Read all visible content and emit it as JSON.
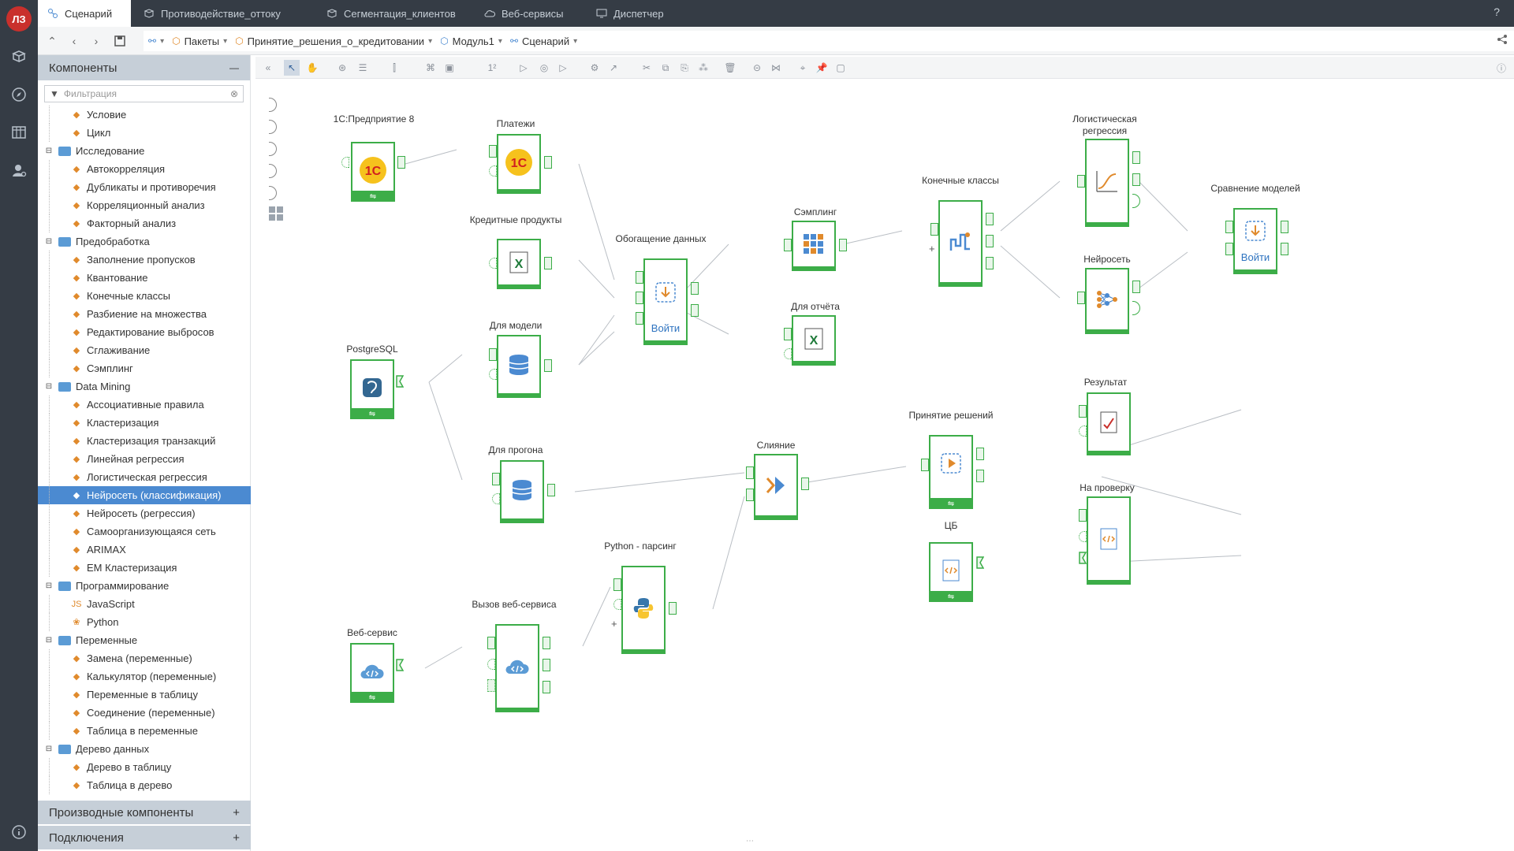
{
  "rail": {
    "logo": "ЛЗ"
  },
  "tabs": [
    {
      "label": "Сценарий",
      "active": true
    },
    {
      "label": "Противодействие_оттоку"
    },
    {
      "label": "Сегментация_клиентов"
    },
    {
      "label": "Веб-сервисы"
    },
    {
      "label": "Диспетчер"
    }
  ],
  "help": "?",
  "breadcrumbs": [
    "Пакеты",
    "Принятие_решения_о_кредитовании",
    "Модуль1",
    "Сценарий"
  ],
  "panel": {
    "title": "Компоненты",
    "filter_placeholder": "Фильтрация",
    "tree": [
      {
        "label": "Условие",
        "level": 2
      },
      {
        "label": "Цикл",
        "level": 2
      },
      {
        "label": "Исследование",
        "level": 1
      },
      {
        "label": "Автокорреляция",
        "level": 2
      },
      {
        "label": "Дубликаты и противоречия",
        "level": 2
      },
      {
        "label": "Корреляционный анализ",
        "level": 2
      },
      {
        "label": "Факторный анализ",
        "level": 2
      },
      {
        "label": "Предобработка",
        "level": 1
      },
      {
        "label": "Заполнение пропусков",
        "level": 2
      },
      {
        "label": "Квантование",
        "level": 2
      },
      {
        "label": "Конечные классы",
        "level": 2
      },
      {
        "label": "Разбиение на множества",
        "level": 2
      },
      {
        "label": "Редактирование выбросов",
        "level": 2
      },
      {
        "label": "Сглаживание",
        "level": 2
      },
      {
        "label": "Сэмплинг",
        "level": 2
      },
      {
        "label": "Data Mining",
        "level": 1
      },
      {
        "label": "Ассоциативные правила",
        "level": 2
      },
      {
        "label": "Кластеризация",
        "level": 2
      },
      {
        "label": "Кластеризация транзакций",
        "level": 2
      },
      {
        "label": "Линейная регрессия",
        "level": 2
      },
      {
        "label": "Логистическая регрессия",
        "level": 2
      },
      {
        "label": "Нейросеть (классификация)",
        "level": 2,
        "selected": true
      },
      {
        "label": "Нейросеть (регрессия)",
        "level": 2
      },
      {
        "label": "Самоорганизующаяся сеть",
        "level": 2
      },
      {
        "label": "ARIMAX",
        "level": 2
      },
      {
        "label": "EM Кластеризация",
        "level": 2
      },
      {
        "label": "Программирование",
        "level": 1
      },
      {
        "label": "JavaScript",
        "level": 2
      },
      {
        "label": "Python",
        "level": 2
      },
      {
        "label": "Переменные",
        "level": 1
      },
      {
        "label": "Замена (переменные)",
        "level": 2
      },
      {
        "label": "Калькулятор (переменные)",
        "level": 2
      },
      {
        "label": "Переменные в таблицу",
        "level": 2
      },
      {
        "label": "Соединение (переменные)",
        "level": 2
      },
      {
        "label": "Таблица в переменные",
        "level": 2
      },
      {
        "label": "Дерево данных",
        "level": 1
      },
      {
        "label": "Дерево в таблицу",
        "level": 2
      },
      {
        "label": "Таблица в дерево",
        "level": 2
      }
    ],
    "derived": "Производные компоненты",
    "connections": "Подключения",
    "plus": "+",
    "minus": "—"
  },
  "nodes": {
    "onec": "1С:Предприятие 8",
    "payments": "Платежи",
    "credit": "Кредитные продукты",
    "enrich": "Обогащение данных",
    "enrich_run": "Войти",
    "sampling": "Сэмплинг",
    "report": "Для отчёта",
    "model": "Для модели",
    "postgres": "PostgreSQL",
    "classes": "Конечные классы",
    "logreg": "Логистическая регрессия",
    "neural": "Нейросеть",
    "compare": "Сравнение моделей",
    "compare_run": "Войти",
    "forecast": "Для прогона",
    "merge": "Слияние",
    "decision": "Принятие решений",
    "result": "Результат",
    "review": "На проверку",
    "cb": "ЦБ",
    "python": "Python - парсинг",
    "wscall": "Вызов веб-сервиса",
    "webservice": "Веб-сервис"
  },
  "colors": {
    "accent": "#3cad48",
    "selection": "#4b8ad1",
    "rail": "#353c45"
  }
}
